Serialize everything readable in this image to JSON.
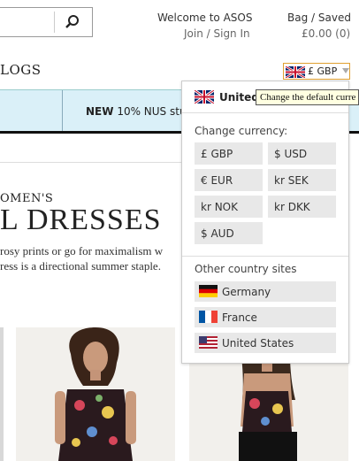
{
  "header": {
    "welcome": "Welcome to ASOS",
    "join": "Join / Sign In",
    "bag": "Bag / Saved",
    "bag_amount": "£0.00 (0)"
  },
  "nav": {
    "partial_label": "LOGS"
  },
  "currency_toggle": {
    "label": "£ GBP"
  },
  "promo": {
    "bold": "NEW",
    "text": "10% NUS stu"
  },
  "page": {
    "kicker": "OMEN'S",
    "title": "L DRESSES",
    "desc_line1": "rosy prints or go for maximalism w",
    "desc_line2": "ress is a directional summer staple."
  },
  "dropdown": {
    "country": "United",
    "tooltip": "Change the default curre",
    "change_currency_label": "Change currency:",
    "currencies": [
      "£ GBP",
      "$ USD",
      "€ EUR",
      "kr SEK",
      "kr NOK",
      "kr DKK",
      "$ AUD"
    ],
    "other_sites_label": "Other country sites",
    "sites": [
      "Germany",
      "France",
      "United States"
    ]
  },
  "colors": {
    "promo_bg": "#daf0f8",
    "toggle_border": "#e0a030",
    "button_bg": "#e8e8e8"
  }
}
